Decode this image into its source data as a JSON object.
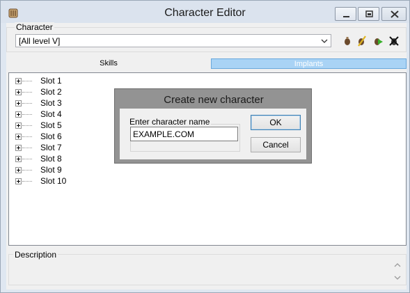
{
  "window": {
    "title": "Character Editor",
    "icons": [
      "app-icon",
      "minimize-icon",
      "maximize-icon",
      "close-icon"
    ]
  },
  "character": {
    "legend": "Character",
    "selected": "[All level V]",
    "tools": [
      "potion-icon",
      "edit-icon",
      "add-icon",
      "delete-icon"
    ]
  },
  "tabs": [
    {
      "label": "Skills",
      "active": true
    },
    {
      "label": "Implants",
      "active": false
    }
  ],
  "tree": {
    "items": [
      "Slot 1",
      "Slot 2",
      "Slot 3",
      "Slot 4",
      "Slot 5",
      "Slot 6",
      "Slot 7",
      "Slot 8",
      "Slot 9",
      "Slot 10"
    ]
  },
  "description": {
    "legend": "Description"
  },
  "dialog": {
    "title": "Create new character",
    "field_label": "Enter character name",
    "field_value": "EXAMPLE.COM",
    "ok_label": "OK",
    "cancel_label": "Cancel"
  },
  "colors": {
    "implants_tab": "#a9d3f5",
    "dialog_frame": "#939393"
  }
}
